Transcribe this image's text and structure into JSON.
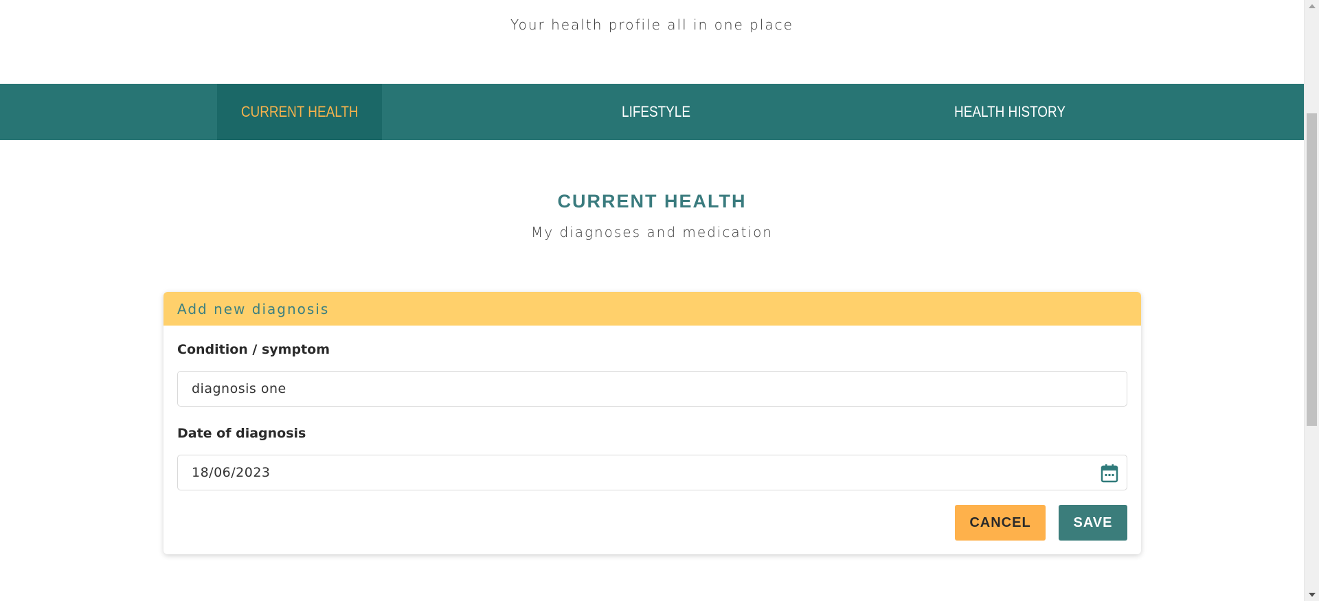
{
  "header": {
    "tagline": "Your health profile all in one place"
  },
  "tabs": [
    {
      "label": "CURRENT HEALTH",
      "active": true
    },
    {
      "label": "LIFESTYLE",
      "active": false
    },
    {
      "label": "HEALTH HISTORY",
      "active": false
    }
  ],
  "section": {
    "title": "CURRENT HEALTH",
    "subtitle": "My diagnoses and medication"
  },
  "form": {
    "title": "Add new diagnosis",
    "condition_label": "Condition / symptom",
    "condition_value": "diagnosis one",
    "date_label": "Date of diagnosis",
    "date_value": "18/06/2023",
    "date_icon": "calendar-icon",
    "cancel_label": "CANCEL",
    "save_label": "SAVE"
  },
  "colors": {
    "tab_bar": "#287574",
    "tab_active_bg": "#1b6867",
    "tab_active_text": "#f6b24c",
    "accent_teal": "#3a7b7e",
    "form_header": "#ffd06b",
    "cancel_button": "#feb14b",
    "save_button": "#3b7d7b"
  }
}
